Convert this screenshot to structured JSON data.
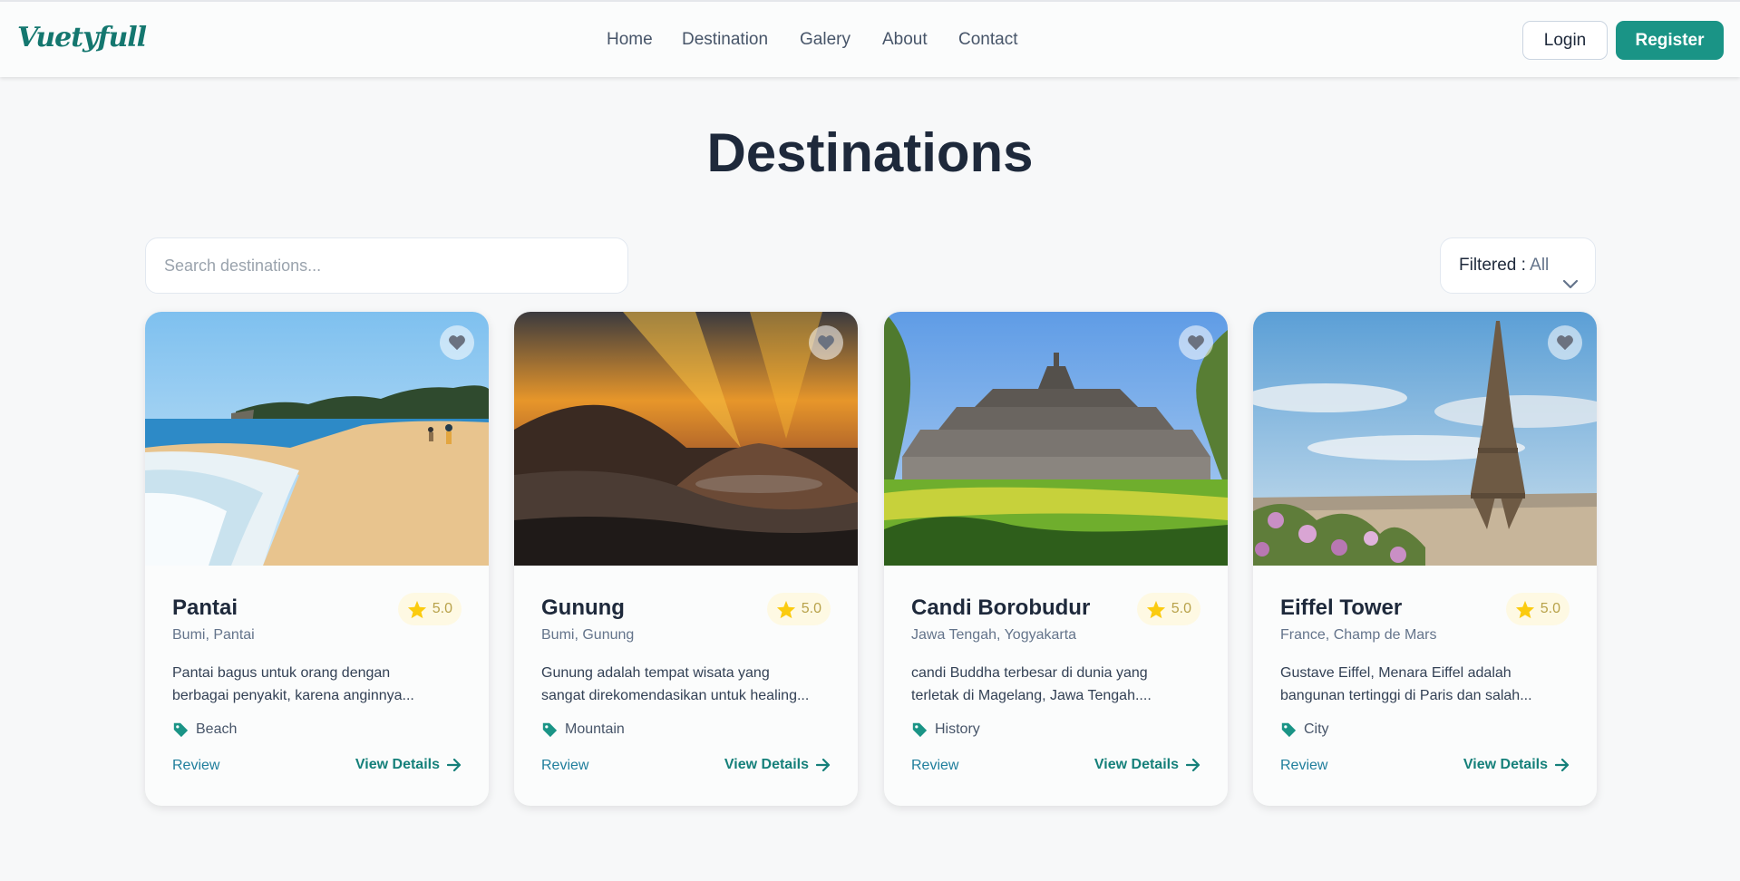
{
  "navbar": {
    "logo": "Vuetyfull",
    "links": [
      {
        "label": "Home"
      },
      {
        "label": "Destination"
      },
      {
        "label": "Galery"
      },
      {
        "label": "About"
      },
      {
        "label": "Contact"
      }
    ],
    "login_label": "Login",
    "register_label": "Register"
  },
  "page": {
    "title": "Destinations",
    "search_placeholder": "Search destinations...",
    "filter": {
      "label": "Filtered :",
      "value": "All"
    }
  },
  "cards": [
    {
      "title": "Pantai",
      "rating": "5.0",
      "location": "Bumi, Pantai",
      "desc_line1": "Pantai bagus untuk orang dengan",
      "desc_line2": "berbagai penyakit, karena anginnya...",
      "tag": "Beach",
      "review_label": "Review",
      "details_label": "View Details"
    },
    {
      "title": "Gunung",
      "rating": "5.0",
      "location": "Bumi, Gunung",
      "desc_line1": "Gunung adalah tempat wisata yang",
      "desc_line2": "sangat direkomendasikan untuk healing...",
      "tag": "Mountain",
      "review_label": "Review",
      "details_label": "View Details"
    },
    {
      "title": "Candi Borobudur",
      "rating": "5.0",
      "location": "Jawa Tengah, Yogyakarta",
      "desc_line1": "candi Buddha terbesar di dunia yang",
      "desc_line2": "terletak di Magelang, Jawa Tengah....",
      "tag": "History",
      "review_label": "Review",
      "details_label": "View Details"
    },
    {
      "title": "Eiffel Tower",
      "rating": "5.0",
      "location": "France, Champ de Mars",
      "desc_line1": "Gustave Eiffel, Menara Eiffel adalah",
      "desc_line2": "bangunan tertinggi di Paris dan salah...",
      "tag": "City",
      "review_label": "Review",
      "details_label": "View Details"
    }
  ],
  "colors": {
    "brand": "#1a9486",
    "logo": "#14776f",
    "link": "#1f7e9c",
    "star": "#fbcb0f"
  }
}
